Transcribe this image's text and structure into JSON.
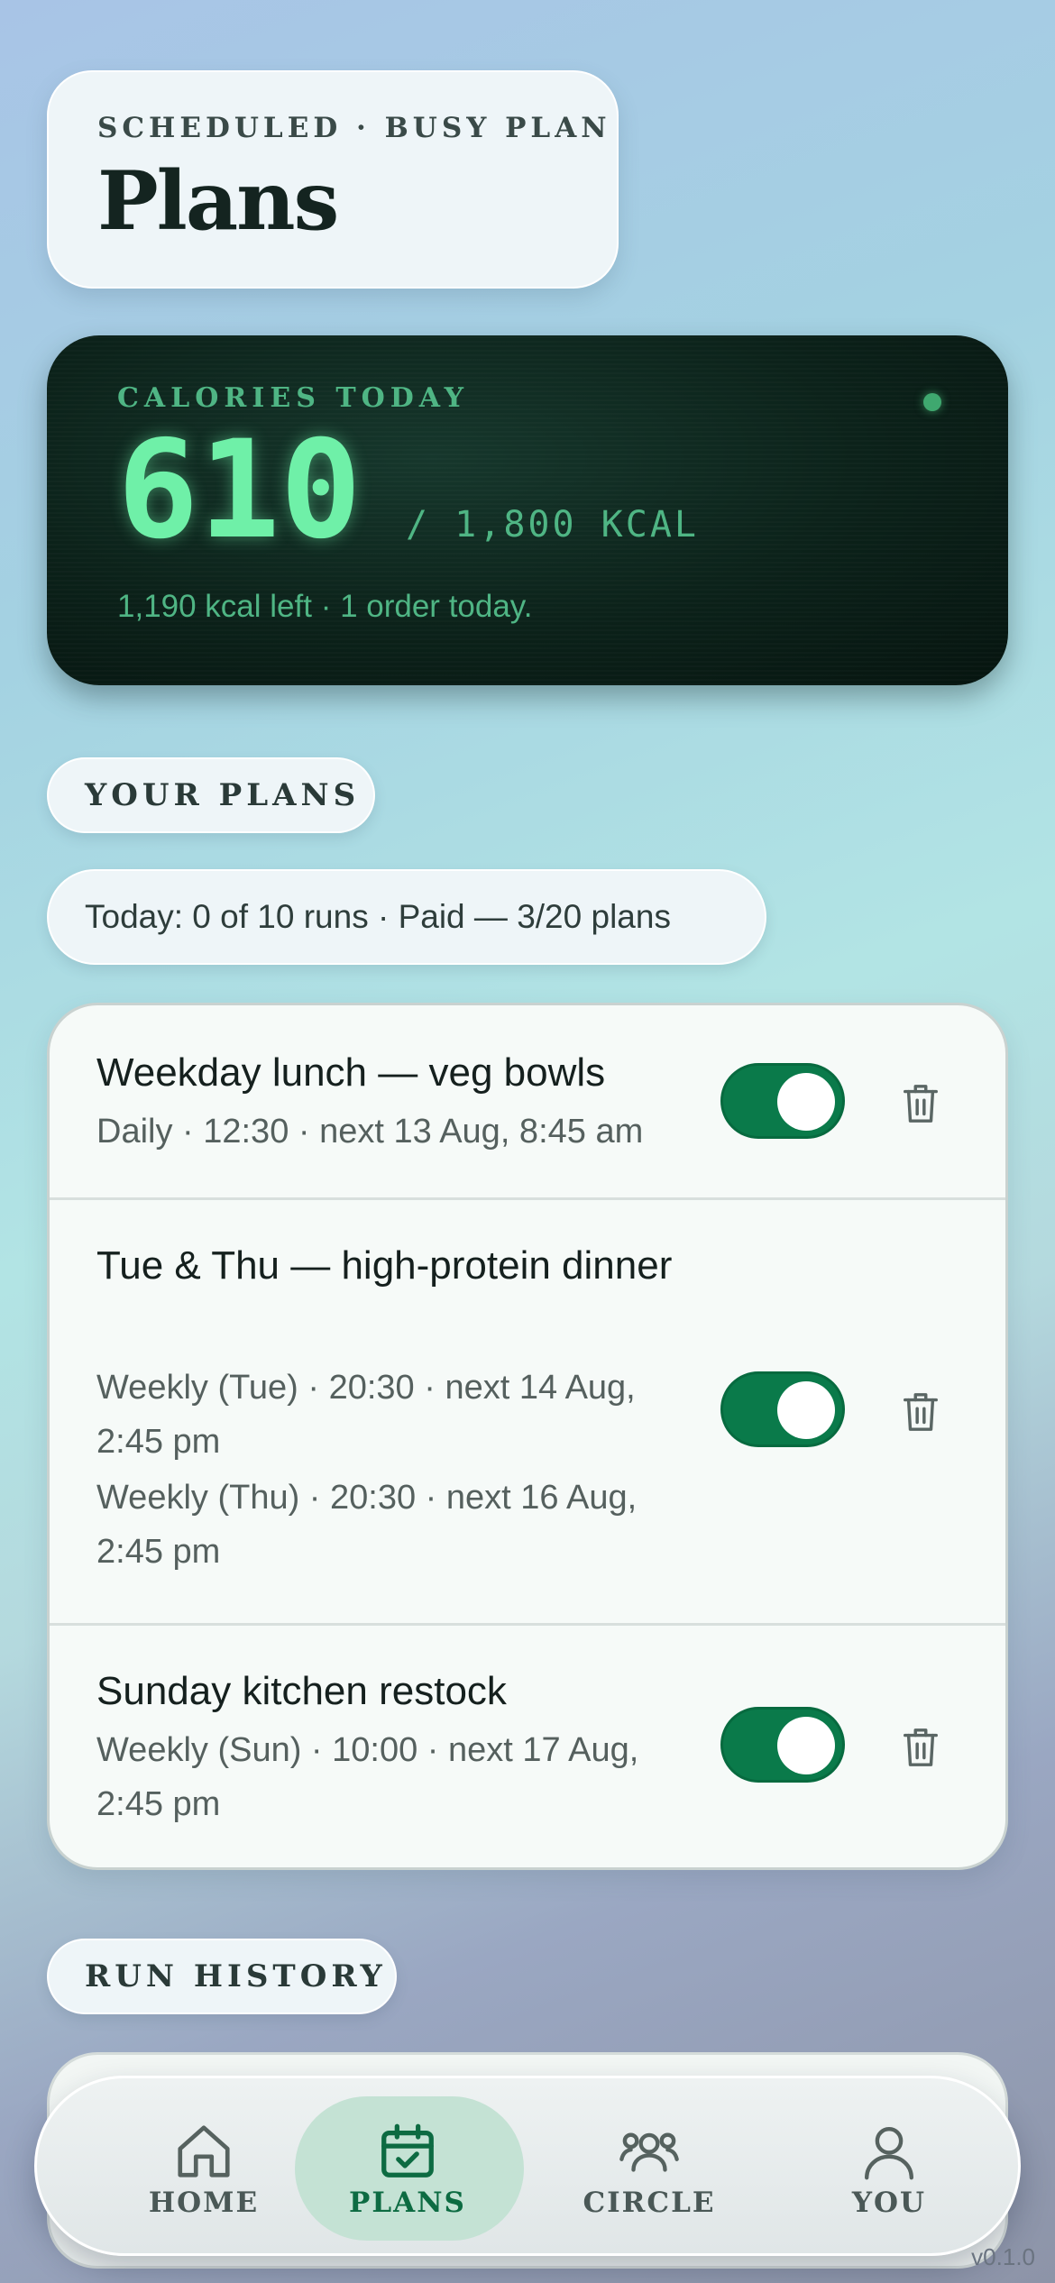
{
  "header": {
    "kicker": "SCHEDULED · BUSY PLAN",
    "title": "Plans"
  },
  "calories": {
    "kicker": "CALORIES TODAY",
    "value": "610",
    "goal": "/ 1,800 KCAL",
    "summary": "1,190 kcal left · 1 order today."
  },
  "plans_section": {
    "label": "YOUR PLANS",
    "summary": "Today: 0 of 10 runs · Paid — 3/20 plans",
    "items": [
      {
        "name": "Weekday lunch — veg bowls",
        "schedules": [
          "Daily · 12:30 · next 13 Aug, 8:45 am"
        ],
        "enabled": true
      },
      {
        "name": "Tue & Thu — high-protein dinner",
        "schedules": [
          "Weekly (Tue) · 20:30 · next 14 Aug, 2:45 pm",
          "Weekly (Thu) · 20:30 · next 16 Aug, 2:45 pm"
        ],
        "enabled": true
      },
      {
        "name": "Sunday kitchen restock",
        "schedules": [
          "Weekly (Sun) · 10:00 · next 17 Aug, 2:45 pm"
        ],
        "enabled": true
      }
    ]
  },
  "history_section": {
    "label": "RUN HISTORY"
  },
  "nav": {
    "items": [
      {
        "label": "HOME",
        "icon": "home-icon"
      },
      {
        "label": "PLANS",
        "icon": "calendar-check-icon",
        "active": true
      },
      {
        "label": "CIRCLE",
        "icon": "group-icon"
      },
      {
        "label": "YOU",
        "icon": "user-icon"
      }
    ]
  },
  "version": "v0.1.0",
  "colors": {
    "accent": "#0a7a4a",
    "calorie_glow": "#6ff0a8",
    "card_dark": "#0b2119"
  }
}
